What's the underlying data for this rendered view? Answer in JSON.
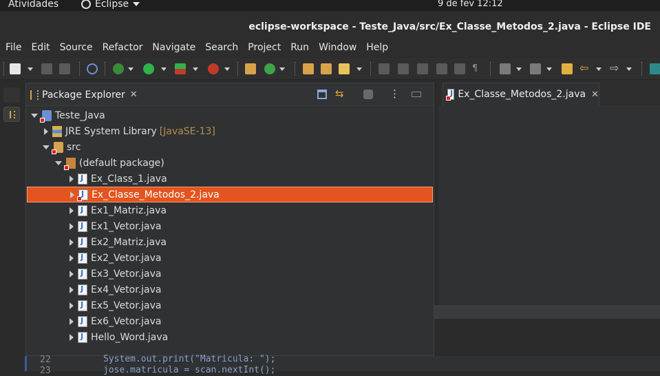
{
  "topbar": {
    "activities": "Atividades",
    "app": "Eclipse",
    "clock": "9 de fev  12:12"
  },
  "window": {
    "title": "eclipse-workspace - Teste_Java/src/Ex_Classe_Metodos_2.java - Eclipse IDE"
  },
  "menu": [
    "File",
    "Edit",
    "Source",
    "Refactor",
    "Navigate",
    "Search",
    "Project",
    "Run",
    "Window",
    "Help"
  ],
  "package_explorer": {
    "tab_label": "Package Explorer",
    "close": "✕",
    "tree": {
      "project": "Teste_Java",
      "jre": "JRE System Library",
      "jre_version": "[JavaSE-13]",
      "src": "src",
      "package": "(default package)",
      "files": [
        "Ex_Class_1.java",
        "Ex_Classe_Metodos_2.java",
        "Ex1_Matriz.java",
        "Ex1_Vetor.java",
        "Ex2_Matriz.java",
        "Ex2_Vetor.java",
        "Ex3_Vetor.java",
        "Ex4_Vetor.java",
        "Ex5_Vetor.java",
        "Ex6_Vetor.java",
        "Hello_Word.java"
      ],
      "selected_file": "Ex_Classe_Metodos_2.java"
    }
  },
  "editor": {
    "tab_label": "Ex_Classe_Metodos_2.java",
    "close": "✕"
  },
  "code": {
    "line22_num": "22",
    "line22": "System.out.print(\"Matricula: \");",
    "line23_num": "23",
    "line23": "jose.matricula = scan.nextInt();"
  },
  "colors": {
    "selection": "#e4541e",
    "background": "#2b2b2b"
  }
}
